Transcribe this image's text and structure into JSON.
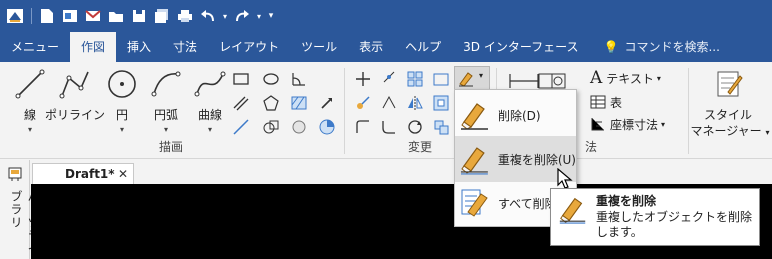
{
  "quick_access": {
    "icons": [
      "app-logo-icon",
      "new-icon",
      "open-icon",
      "email-icon",
      "folder-icon",
      "save-icon",
      "save-all-icon",
      "print-icon",
      "undo-icon",
      "redo-icon",
      "customize-icon"
    ]
  },
  "tabs": [
    {
      "label": "メニュー"
    },
    {
      "label": "作図"
    },
    {
      "label": "挿入"
    },
    {
      "label": "寸法"
    },
    {
      "label": "レイアウト"
    },
    {
      "label": "ツール"
    },
    {
      "label": "表示"
    },
    {
      "label": "ヘルプ"
    },
    {
      "label": "3D インターフェース"
    }
  ],
  "search": {
    "placeholder": "コマンドを検索..."
  },
  "ribbon": {
    "draw": {
      "group_label": "描画",
      "line": "線",
      "polyline": "ポリライン",
      "circle": "円",
      "arc": "円弧",
      "curve": "曲線"
    },
    "modify": {
      "group_label": "変更"
    },
    "annotation": {
      "text": "テキスト",
      "table": "表",
      "coord_dim": "座標寸法",
      "group_label_partial": "法"
    },
    "style": {
      "line1": "スタイル",
      "line2": "マネージャー"
    }
  },
  "document": {
    "tab": "Draft1*",
    "close": "✕"
  },
  "sidepanel": {
    "label": "パーツライブラリ"
  },
  "dropdown": {
    "items": [
      {
        "label": "削除(D)"
      },
      {
        "label": "重複を削除(U)"
      },
      {
        "label": "すべて削除"
      }
    ]
  },
  "tooltip": {
    "title": "重複を削除",
    "body": "重複したオブジェクトを削除します。"
  },
  "colors": {
    "brand": "#2b579a",
    "ribbon_bg": "#f3f3f3",
    "canvas": "#000000",
    "accent_orange": "#e8a83c"
  }
}
